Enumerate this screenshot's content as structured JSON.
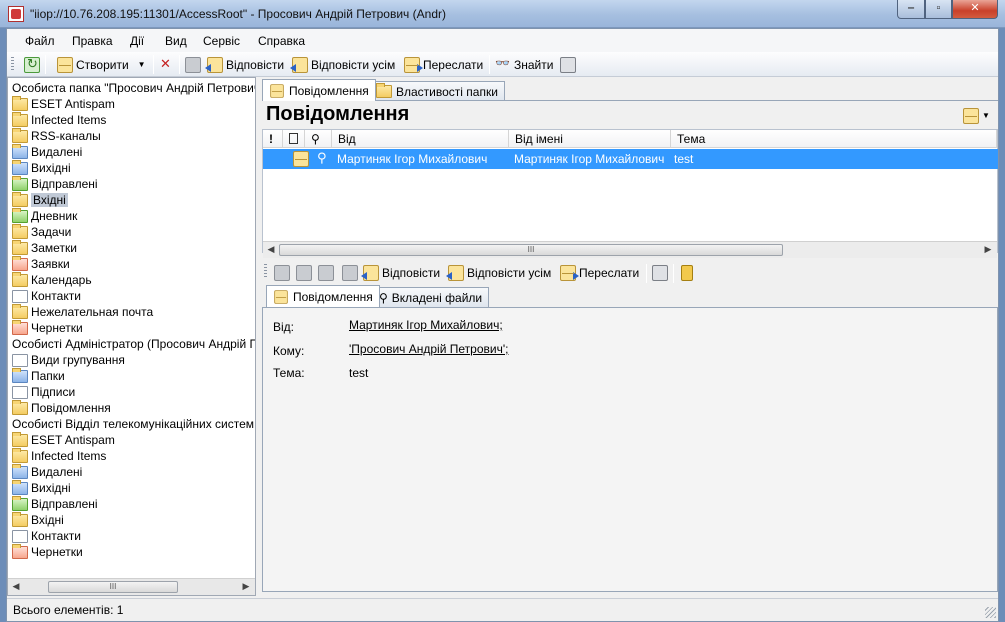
{
  "window": {
    "title": "\"iiop://10.76.208.195:11301/AccessRoot\" - Просович Андрій Петрович (Andr)",
    "minimize": "‒",
    "maximize": "▫",
    "close": "✕"
  },
  "menu": [
    "Файл",
    "Правка",
    "Дії",
    "Вид",
    "Сервіс",
    "Справка"
  ],
  "toolbar": {
    "create": "Створити",
    "reply": "Відповісти",
    "reply_all": "Відповісти усім",
    "forward": "Переслати",
    "find": "Знайти"
  },
  "tree": {
    "group1": {
      "title": "Особиста папка \"Просович Андрій Петрович\"",
      "items": [
        "ESET Antispam",
        "Infected Items",
        "RSS-каналы",
        "Видалені",
        "Вихідні",
        "Відправлені",
        "Вхідні",
        "Дневник",
        "Задачи",
        "Заметки",
        "Заявки",
        "Календарь",
        "Контакти",
        "Нежелательная почта",
        "Чернетки"
      ]
    },
    "group2": {
      "title": "Особисті Адміністратор (Просович Андрій Петро",
      "items": [
        "Види групування",
        "Папки",
        "Підписи",
        "Повідомлення"
      ]
    },
    "group3": {
      "title": "Особисті Відділ телекомунікаційних систем м. Л",
      "items": [
        "ESET Antispam",
        "Infected Items",
        "Видалені",
        "Вихідні",
        "Відправлені",
        "Вхідні",
        "Контакти",
        "Чернетки"
      ]
    },
    "scroll_label": "III"
  },
  "tabs": {
    "messages": "Повідомлення",
    "folder_props": "Властивості папки"
  },
  "list": {
    "heading": "Повідомлення",
    "columns": {
      "importance": "!",
      "from": "Від",
      "from_name": "Від імені",
      "subject": "Тема"
    },
    "rows": [
      {
        "from": "Мартиняк Ігор Михайлович",
        "from_name": "Мартиняк Ігор Михайлович",
        "subject": "test"
      }
    ],
    "scroll_label": "III"
  },
  "preview_toolbar": {
    "reply": "Відповісти",
    "reply_all": "Відповісти усім",
    "forward": "Переслати"
  },
  "preview_tabs": {
    "message": "Повідомлення",
    "attachments": "Вкладені файли"
  },
  "preview": {
    "from_label": "Від:",
    "from_value": "Мартиняк Ігор Михайлович;",
    "to_label": "Кому:",
    "to_value": "'Просович Андрій Петрович';",
    "subject_label": "Тема:",
    "subject_value": "test"
  },
  "status": {
    "text": "Всього елементів: 1"
  },
  "colors": {
    "selection": "#3399ff",
    "titlebar": "#a6bfe0"
  }
}
